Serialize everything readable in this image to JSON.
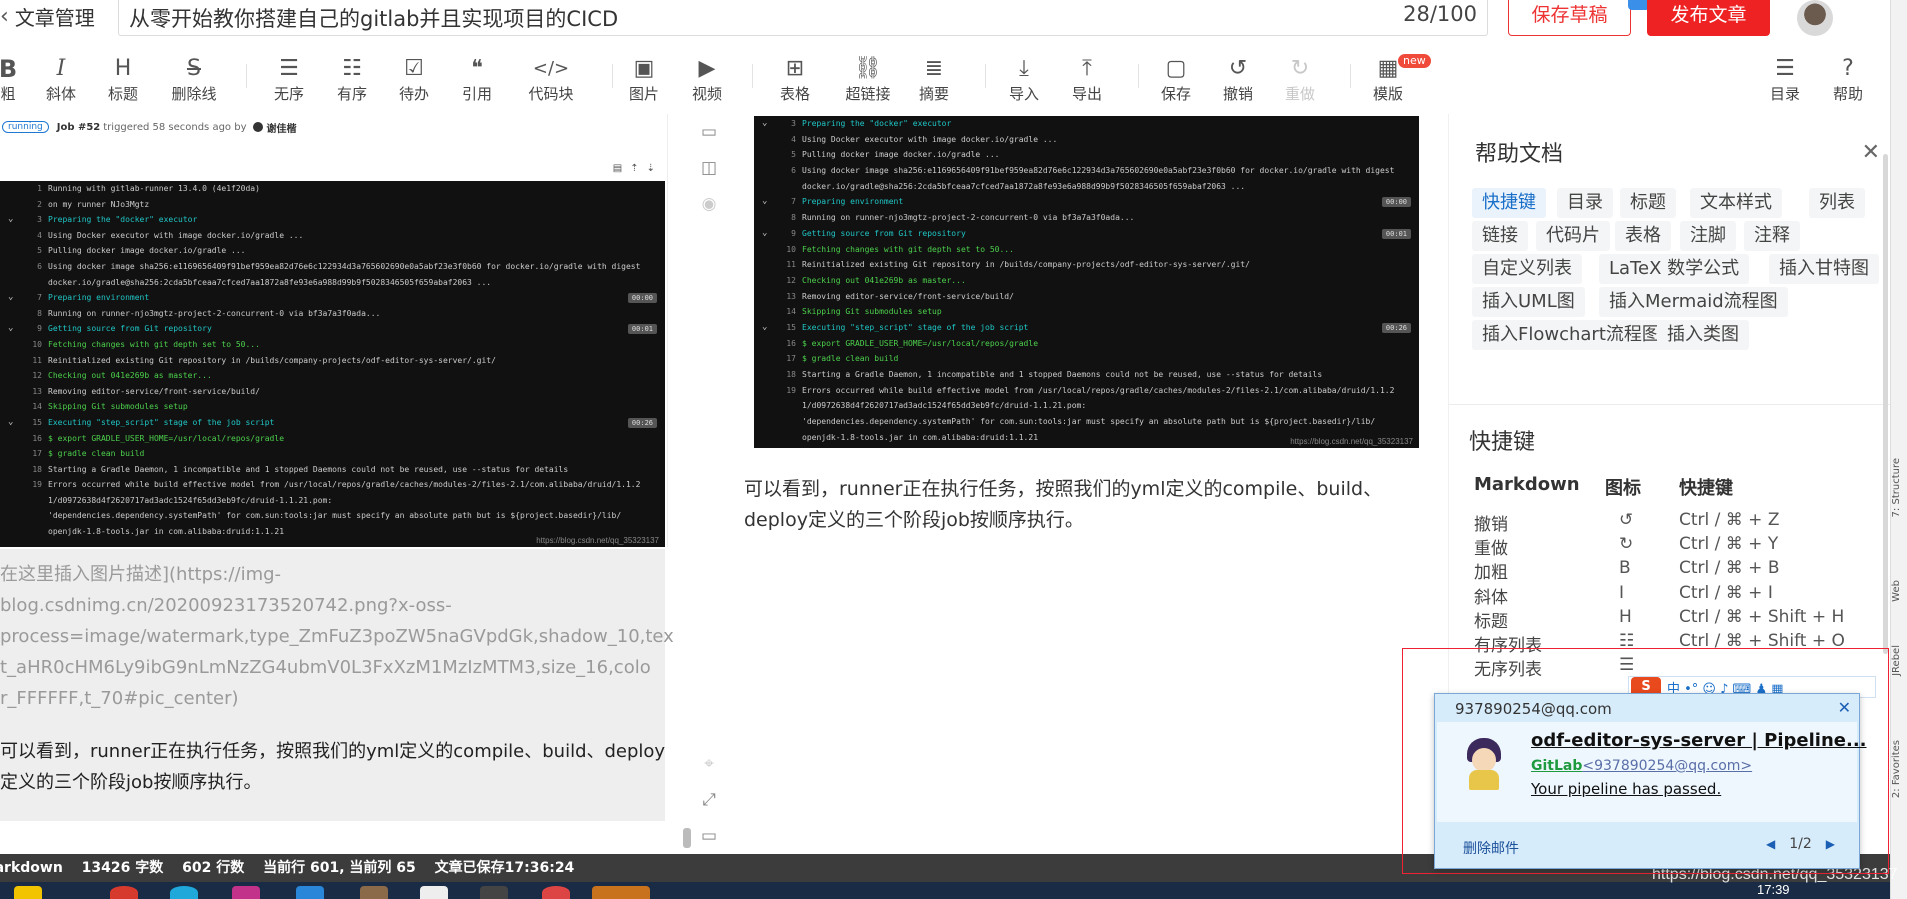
{
  "header": {
    "back_label": "文章管理",
    "title": "从零开始教你搭建自己的gitlab并且实现项目的CICD",
    "title_count": "28/100",
    "save_draft": "保存草稿",
    "publish": "发布文章"
  },
  "toolbar": {
    "bold": {
      "icon": "B",
      "label": "粗"
    },
    "italic": {
      "icon": "I",
      "label": "斜体"
    },
    "heading": {
      "icon": "H",
      "label": "标题"
    },
    "strike": {
      "icon": "S",
      "label": "删除线"
    },
    "ul": {
      "icon": "☰",
      "label": "无序"
    },
    "ol": {
      "icon": "☷",
      "label": "有序"
    },
    "todo": {
      "icon": "☑",
      "label": "待办"
    },
    "quote": {
      "icon": "❝",
      "label": "引用"
    },
    "code": {
      "icon": "</>",
      "label": "代码块"
    },
    "image": {
      "icon": "▣",
      "label": "图片"
    },
    "video": {
      "icon": "▶",
      "label": "视频"
    },
    "table": {
      "icon": "⊞",
      "label": "表格"
    },
    "link": {
      "icon": "⛓",
      "label": "超链接"
    },
    "summary": {
      "icon": "≣",
      "label": "摘要"
    },
    "import": {
      "icon": "⤓",
      "label": "导入"
    },
    "export": {
      "icon": "⤒",
      "label": "导出"
    },
    "save": {
      "icon": "▢",
      "label": "保存"
    },
    "undo": {
      "icon": "↺",
      "label": "撤销"
    },
    "redo": {
      "icon": "↻",
      "label": "重做"
    },
    "template": {
      "icon": "▦",
      "label": "模版",
      "badge": "new"
    },
    "toc": {
      "icon": "☰",
      "label": "目录"
    },
    "help": {
      "icon": "?",
      "label": "帮助"
    }
  },
  "gitlab": {
    "status": "running",
    "job": "Job #52",
    "triggered": "triggered 58 seconds ago by",
    "user": "谢佳楷"
  },
  "log_left": [
    {
      "n": "1",
      "t": "Running with gitlab-runner 13.4.0 (4e1f20da)",
      "k": ""
    },
    {
      "n": "2",
      "t": "  on my runner NJo3Mgtz",
      "k": ""
    },
    {
      "n": "3",
      "t": "Preparing the \"docker\" executor",
      "k": "h",
      "chev": true
    },
    {
      "n": "4",
      "t": "Using Docker executor with image docker.io/gradle ...",
      "k": ""
    },
    {
      "n": "5",
      "t": "Pulling docker image docker.io/gradle ...",
      "k": ""
    },
    {
      "n": "6",
      "t": "Using docker image sha256:e1169656409f91bef959ea82d76e6c122934d3a765602690e0a5abf23e3f0b60 for docker.io/gradle with digest",
      "k": ""
    },
    {
      "n": "",
      "t": "docker.io/gradle@sha256:2cda5bfceaa7cfced7aa1872a8fe93e6a988d99b9f5028346505f659abaf2063 ...",
      "k": ""
    },
    {
      "n": "7",
      "t": "Preparing environment",
      "k": "h",
      "chev": true,
      "tm": "00:00"
    },
    {
      "n": "8",
      "t": "Running on runner-njo3mgtz-project-2-concurrent-0 via bf3a7a3f0ada...",
      "k": ""
    },
    {
      "n": "9",
      "t": "Getting source from Git repository",
      "k": "h",
      "chev": true,
      "tm": "00:01"
    },
    {
      "n": "10",
      "t": "Fetching changes with git depth set to 50...",
      "k": "g"
    },
    {
      "n": "11",
      "t": "Reinitialized existing Git repository in /builds/company-projects/odf-editor-sys-server/.git/",
      "k": ""
    },
    {
      "n": "12",
      "t": "Checking out 041e269b as master...",
      "k": "g"
    },
    {
      "n": "13",
      "t": "Removing editor-service/front-service/build/",
      "k": ""
    },
    {
      "n": "14",
      "t": "Skipping Git submodules setup",
      "k": "g"
    },
    {
      "n": "15",
      "t": "Executing \"step_script\" stage of the job script",
      "k": "h",
      "chev": true,
      "tm": "00:26"
    },
    {
      "n": "16",
      "t": "$ export GRADLE_USER_HOME=/usr/local/repos/gradle",
      "k": "g"
    },
    {
      "n": "17",
      "t": "$ gradle clean build",
      "k": "g"
    },
    {
      "n": "18",
      "t": "Starting a Gradle Daemon, 1 incompatible and 1 stopped Daemons could not be reused, use --status for details",
      "k": ""
    },
    {
      "n": "19",
      "t": "Errors occurred while build effective model from /usr/local/repos/gradle/caches/modules-2/files-2.1/com.alibaba/druid/1.1.2",
      "k": ""
    },
    {
      "n": "",
      "t": "1/d0972638d4f2620717ad3adc1524f65dd3eb9fc/druid-1.1.21.pom:",
      "k": ""
    },
    {
      "n": "",
      "t": "    'dependencies.dependency.systemPath' for com.sun:tools:jar must specify an absolute path but is ${project.basedir}/lib/",
      "k": ""
    },
    {
      "n": "",
      "t": "  openjdk-1.8-tools.jar in com.alibaba:druid:1.1.21",
      "k": ""
    }
  ],
  "log_right": [
    {
      "n": "3",
      "t": "Preparing the \"docker\" executor",
      "k": "h",
      "chev": true
    },
    {
      "n": "4",
      "t": "Using Docker executor with image docker.io/gradle ...",
      "k": ""
    },
    {
      "n": "5",
      "t": "Pulling docker image docker.io/gradle ...",
      "k": ""
    },
    {
      "n": "6",
      "t": "Using docker image sha256:e1169656409f91bef959ea82d76e6c122934d3a765602690e0a5abf23e3f0b60 for docker.io/gradle with digest",
      "k": ""
    },
    {
      "n": "",
      "t": "docker.io/gradle@sha256:2cda5bfceaa7cfced7aa1872a8fe93e6a988d99b9f5028346505f659abaf2063 ...",
      "k": ""
    },
    {
      "n": "7",
      "t": "Preparing environment",
      "k": "h",
      "chev": true,
      "tm": "00:00"
    },
    {
      "n": "8",
      "t": "Running on runner-njo3mgtz-project-2-concurrent-0 via bf3a7a3f0ada...",
      "k": ""
    },
    {
      "n": "9",
      "t": "Getting source from Git repository",
      "k": "h",
      "chev": true,
      "tm": "00:01"
    },
    {
      "n": "10",
      "t": "Fetching changes with git depth set to 50...",
      "k": "g"
    },
    {
      "n": "11",
      "t": "Reinitialized existing Git repository in /builds/company-projects/odf-editor-sys-server/.git/",
      "k": ""
    },
    {
      "n": "12",
      "t": "Checking out 041e269b as master...",
      "k": "g"
    },
    {
      "n": "13",
      "t": "Removing editor-service/front-service/build/",
      "k": ""
    },
    {
      "n": "14",
      "t": "Skipping Git submodules setup",
      "k": "g"
    },
    {
      "n": "15",
      "t": "Executing \"step_script\" stage of the job script",
      "k": "h",
      "chev": true,
      "tm": "00:26"
    },
    {
      "n": "16",
      "t": "$ export GRADLE_USER_HOME=/usr/local/repos/gradle",
      "k": "g"
    },
    {
      "n": "17",
      "t": "$ gradle clean build",
      "k": "g"
    },
    {
      "n": "18",
      "t": "Starting a Gradle Daemon, 1 incompatible and 1 stopped Daemons could not be reused, use --status for details",
      "k": ""
    },
    {
      "n": "19",
      "t": "Errors occurred while build effective model from /usr/local/repos/gradle/caches/modules-2/files-2.1/com.alibaba/druid/1.1.2",
      "k": ""
    },
    {
      "n": "",
      "t": "1/d0972638d4f2620717ad3adc1524f65dd3eb9fc/druid-1.1.21.pom:",
      "k": ""
    },
    {
      "n": "",
      "t": "    'dependencies.dependency.systemPath' for com.sun:tools:jar must specify an absolute path but is ${project.basedir}/lib/",
      "k": ""
    },
    {
      "n": "",
      "t": "  openjdk-1.8-tools.jar in com.alibaba:druid:1.1.21",
      "k": ""
    }
  ],
  "watermark": "https://blog.csdn.net/qq_35323137",
  "editor_img_lines": [
    "在这里插入图片描述](https://img-",
    "blog.csdnimg.cn/20200923173520742.png?x-oss-",
    "process=image/watermark,type_ZmFuZ3poZW5naGVpdGk,shadow_10,tex",
    "t_aHR0cHM6Ly9ibG9nLmNzZG4ubmV0L3FxXzM1MzIzMTM3,size_16,colo",
    "r_FFFFFF,t_70#pic_center)"
  ],
  "editor_para": "可以看到，runner正在执行任务，按照我们的yml定义的compile、build、deploy定义的三个阶段job按顺序执行。",
  "preview_para": "可以看到，runner正在执行任务，按照我们的yml定义的compile、build、deploy定义的三个阶段job按顺序执行。",
  "help": {
    "title": "帮助文档",
    "tags": [
      "快捷键",
      "目录",
      "标题",
      "文本样式",
      "列表",
      "链接",
      "代码片",
      "表格",
      "注脚",
      "注释",
      "自定义列表",
      "LaTeX 数学公式",
      "插入甘特图",
      "插入UML图",
      "插入Mermaid流程图",
      "插入Flowchart流程图",
      "插入类图"
    ],
    "shortcuts_title": "快捷键",
    "col_markdown": "Markdown",
    "col_icon": "图标",
    "col_shortcut": "快捷键",
    "rows": [
      {
        "name": "撤销",
        "icon": "↺",
        "key": "Ctrl / ⌘ + Z"
      },
      {
        "name": "重做",
        "icon": "↻",
        "key": "Ctrl / ⌘ + Y"
      },
      {
        "name": "加粗",
        "icon": "B",
        "key": "Ctrl / ⌘ + B"
      },
      {
        "name": "斜体",
        "icon": "I",
        "key": "Ctrl / ⌘ + I"
      },
      {
        "name": "标题",
        "icon": "H",
        "key": "Ctrl / ⌘ + Shift + H"
      },
      {
        "name": "有序列表",
        "icon": "☷",
        "key": "Ctrl / ⌘ + Shift + O"
      },
      {
        "name": "无序列表",
        "icon": "☰",
        "key": ""
      }
    ]
  },
  "status": {
    "mode": "markdown",
    "words": "13426 字数",
    "lines": "602 行数",
    "cursor": "当前行 601, 当前列 65",
    "saved": "文章已保存17:36:24"
  },
  "mail": {
    "account": "937890254@qq.com",
    "subject": "odf-editor-sys-server | Pipeline...",
    "sender_name": "GitLab",
    "sender_addr": "<937890254@qq.com>",
    "message": "Your pipeline has passed.",
    "delete": "删除邮件",
    "pager": "1/2"
  },
  "ide": {
    "structure": "7: Structure",
    "web": "Web",
    "jrebel": "JRebel",
    "favorites": "2: Favorites"
  },
  "clock": "17:39"
}
